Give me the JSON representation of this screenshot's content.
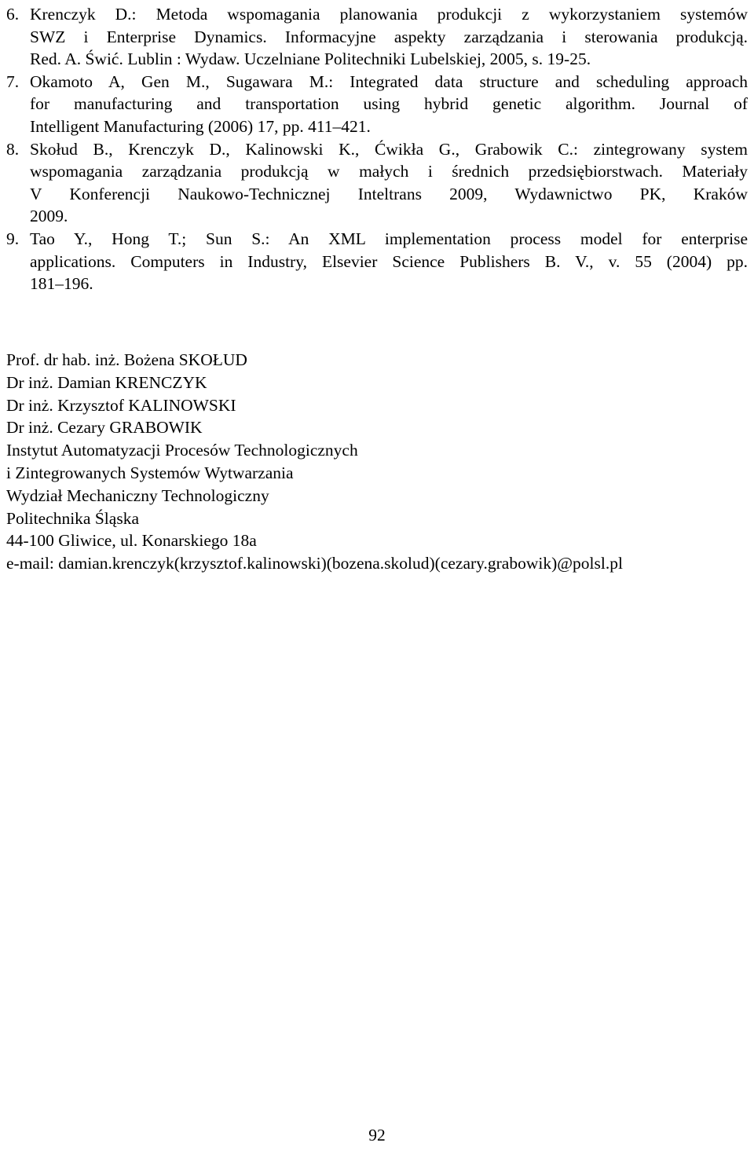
{
  "document": {
    "page_number": "92",
    "references": [
      {
        "number": "6.",
        "lines": [
          "Krenczyk D.: Metoda wspomagania planowania produkcji z wykorzystaniem systemów",
          "SWZ i Enterprise Dynamics. Informacyjne aspekty zarządzania i sterowania produkcją.",
          "Red. A. Świć. Lublin : Wydaw. Uczelniane Politechniki Lubelskiej, 2005, s. 19-25."
        ],
        "text": "Krenczyk D.: Metoda wspomagania planowania produkcji z wykorzystaniem systemów SWZ i Enterprise Dynamics. Informacyjne aspekty zarządzania i sterowania produkcją. Red. A. Świć. Lublin : Wydaw. Uczelniane Politechniki Lubelskiej, 2005, s. 19-25."
      },
      {
        "number": "7.",
        "lines": [
          "Okamoto A, Gen M., Sugawara M.: Integrated data structure and scheduling approach",
          "for manufacturing and transportation using hybrid genetic algorithm. Journal of",
          "Intelligent Manufacturing (2006) 17, pp. 411–421."
        ],
        "text": "Okamoto A, Gen M., Sugawara M.: Integrated data structure and scheduling approach for manufacturing and transportation using hybrid genetic algorithm. Journal of Intelligent Manufacturing (2006) 17, pp. 411–421."
      },
      {
        "number": "8.",
        "lines": [
          "Skołud B., Krenczyk D., Kalinowski K., Ćwikła G., Grabowik C.: zintegrowany system",
          "wspomagania zarządzania produkcją w małych i średnich przedsiębiorstwach. Materiały",
          "V Konferencji Naukowo-Technicznej Inteltrans 2009, Wydawnictwo PK, Kraków",
          "2009."
        ],
        "text": "Skołud B., Krenczyk D., Kalinowski K., Ćwikła G., Grabowik C.: zintegrowany system wspomagania zarządzania produkcją w małych i średnich przedsiębiorstwach. Materiały V Konferencji Naukowo-Technicznej Inteltrans 2009, Wydawnictwo PK, Kraków 2009."
      },
      {
        "number": "9.",
        "lines": [
          "Tao Y., Hong T.; Sun S.: An XML implementation process model for enterprise",
          "applications. Computers in Industry, Elsevier Science Publishers B. V., v. 55 (2004) pp.",
          "181–196."
        ],
        "text": "Tao Y., Hong T.; Sun S.: An XML implementation process model for enterprise applications. Computers in Industry, Elsevier Science Publishers B. V., v. 55 (2004) pp. 181–196."
      }
    ],
    "author_block": [
      "Prof. dr hab. inż. Bożena SKOŁUD",
      "Dr inż. Damian KRENCZYK",
      "Dr inż. Krzysztof KALINOWSKI",
      "Dr inż. Cezary GRABOWIK",
      "Instytut Automatyzacji Procesów Technologicznych",
      "i Zintegrowanych Systemów Wytwarzania",
      "Wydział Mechaniczny Technologiczny",
      "Politechnika Śląska",
      "44-100 Gliwice, ul. Konarskiego 18a",
      "e-mail: damian.krenczyk(krzysztof.kalinowski)(bozena.skolud)(cezary.grabowik)@polsl.pl"
    ]
  }
}
